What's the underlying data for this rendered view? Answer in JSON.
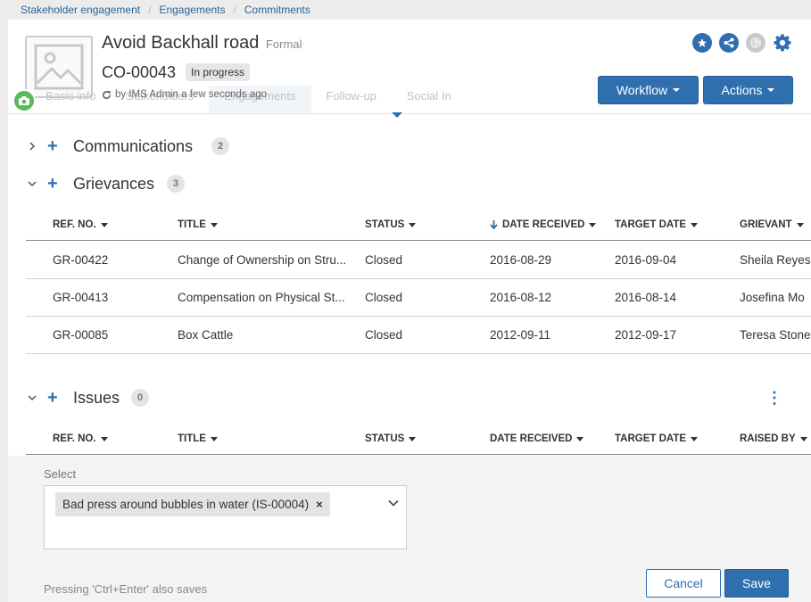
{
  "breadcrumb": [
    "Stakeholder engagement",
    "Engagements",
    "Commitments"
  ],
  "header": {
    "title": "Avoid Backhall road",
    "type": "Formal",
    "code": "CO-00043",
    "status": "In progress",
    "byline": "by IMS Admin a few seconds ago",
    "workflow_label": "Workflow",
    "actions_label": "Actions",
    "icons": [
      "star-icon",
      "share-icon",
      "globe-icon",
      "gear-icon"
    ]
  },
  "tabs": [
    "Basic info",
    "Stakeholders",
    "Engagements",
    "Follow-up",
    "Social In"
  ],
  "communications": {
    "title": "Communications",
    "count": "2"
  },
  "grievances": {
    "title": "Grievances",
    "count": "3",
    "columns": [
      "REF. NO.",
      "TITLE",
      "STATUS",
      "DATE RECEIVED",
      "TARGET DATE",
      "GRIEVANT"
    ],
    "rows": [
      [
        "GR-00422",
        "Change of Ownership on Stru...",
        "Closed",
        "2016-08-29",
        "2016-09-04",
        "Sheila Reyes"
      ],
      [
        "GR-00413",
        "Compensation on Physical St...",
        "Closed",
        "2016-08-12",
        "2016-08-14",
        "Josefina Mo"
      ],
      [
        "GR-00085",
        "Box Cattle",
        "Closed",
        "2012-09-11",
        "2012-09-17",
        "Teresa Stone"
      ]
    ]
  },
  "issues": {
    "title": "Issues",
    "count": "0",
    "columns": [
      "REF. NO.",
      "TITLE",
      "STATUS",
      "DATE RECEIVED",
      "TARGET DATE",
      "RAISED BY"
    ]
  },
  "select_panel": {
    "label": "Select",
    "chip": "Bad press around bubbles in water (IS-00004)",
    "chip_remove": "×",
    "hint": "Pressing 'Ctrl+Enter' also saves",
    "cancel_label": "Cancel",
    "save_label": "Save"
  },
  "colors": {
    "primary": "#2f6fad",
    "success": "#5cb85c",
    "muted": "#c9c9c9"
  }
}
